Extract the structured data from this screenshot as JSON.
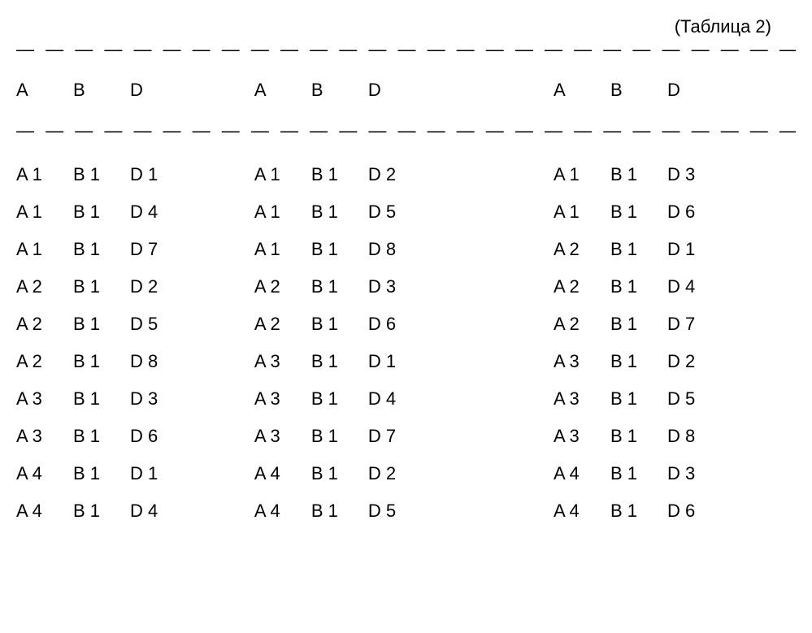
{
  "title": "(Таблица 2)",
  "dashes": "— — — — — — — — — — — — — — — — — — — — — — — — — — — — —",
  "headers": {
    "a": "A",
    "b": "B",
    "d": "D"
  },
  "rows": [
    [
      {
        "a": "A 1",
        "b": "B 1",
        "d": "D 1"
      },
      {
        "a": "A 1",
        "b": "B 1",
        "d": "D 2"
      },
      {
        "a": "A 1",
        "b": "B 1",
        "d": "D 3"
      }
    ],
    [
      {
        "a": "A 1",
        "b": "B 1",
        "d": "D 4"
      },
      {
        "a": "A 1",
        "b": "B 1",
        "d": "D 5"
      },
      {
        "a": "A 1",
        "b": "B 1",
        "d": "D 6"
      }
    ],
    [
      {
        "a": "A 1",
        "b": "B 1",
        "d": "D 7"
      },
      {
        "a": "A 1",
        "b": "B 1",
        "d": "D 8"
      },
      {
        "a": "A 2",
        "b": "B 1",
        "d": "D 1"
      }
    ],
    [
      {
        "a": "A 2",
        "b": "B 1",
        "d": "D 2"
      },
      {
        "a": "A 2",
        "b": "B 1",
        "d": "D 3"
      },
      {
        "a": "A 2",
        "b": "B 1",
        "d": "D 4"
      }
    ],
    [
      {
        "a": "A 2",
        "b": "B 1",
        "d": "D 5"
      },
      {
        "a": "A 2",
        "b": "B 1",
        "d": "D 6"
      },
      {
        "a": "A 2",
        "b": "B 1",
        "d": "D 7"
      }
    ],
    [
      {
        "a": "A 2",
        "b": "B 1",
        "d": "D 8"
      },
      {
        "a": "A 3",
        "b": "B 1",
        "d": "D 1"
      },
      {
        "a": "A 3",
        "b": "B 1",
        "d": "D 2"
      }
    ],
    [
      {
        "a": "A 3",
        "b": "B 1",
        "d": "D 3"
      },
      {
        "a": "A 3",
        "b": "B 1",
        "d": "D 4"
      },
      {
        "a": "A 3",
        "b": "B 1",
        "d": "D 5"
      }
    ],
    [
      {
        "a": "A 3",
        "b": "B 1",
        "d": "D 6"
      },
      {
        "a": "A 3",
        "b": "B 1",
        "d": "D 7"
      },
      {
        "a": "A 3",
        "b": "B 1",
        "d": "D 8"
      }
    ],
    [
      {
        "a": "A 4",
        "b": "B 1",
        "d": "D 1"
      },
      {
        "a": "A 4",
        "b": "B 1",
        "d": "D 2"
      },
      {
        "a": "A 4",
        "b": "B 1",
        "d": "D 3"
      }
    ],
    [
      {
        "a": "A 4",
        "b": "B 1",
        "d": "D 4"
      },
      {
        "a": "A 4",
        "b": "B 1",
        "d": "D 5"
      },
      {
        "a": "A 4",
        "b": "B 1",
        "d": "D 6"
      }
    ]
  ]
}
